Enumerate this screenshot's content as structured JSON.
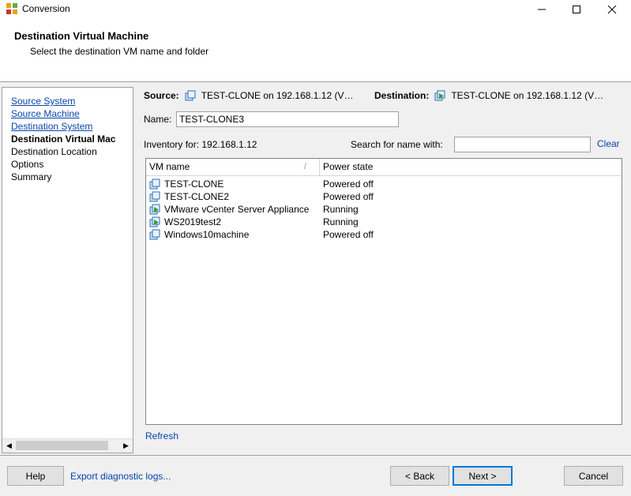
{
  "window": {
    "title": "Conversion",
    "minimize_glyph": "—",
    "maximize_glyph": "☐",
    "close_glyph": "✕"
  },
  "header": {
    "title": "Destination Virtual Machine",
    "subtitle": "Select the destination VM name and folder"
  },
  "nav": {
    "items": [
      {
        "label": "Source System",
        "state": "link"
      },
      {
        "label": "Source Machine",
        "state": "link"
      },
      {
        "label": "Destination System",
        "state": "link"
      },
      {
        "label": "Destination Virtual Mac",
        "state": "current"
      },
      {
        "label": "Destination Location",
        "state": "pending"
      },
      {
        "label": "Options",
        "state": "pending"
      },
      {
        "label": "Summary",
        "state": "pending"
      }
    ]
  },
  "summary": {
    "source_label": "Source:",
    "source_value": "TEST-CLONE on 192.168.1.12 (V…",
    "destination_label": "Destination:",
    "destination_value": "TEST-CLONE on 192.168.1.12 (V…"
  },
  "form": {
    "name_label": "Name:",
    "name_value": "TEST-CLONE3",
    "inventory_label": "Inventory for:",
    "inventory_value": "192.168.1.12",
    "search_label": "Search for name with:",
    "search_value": "",
    "clear_label": "Clear",
    "refresh_label": "Refresh"
  },
  "table": {
    "columns": [
      "VM name",
      "Power state"
    ],
    "rows": [
      {
        "name": "TEST-CLONE",
        "state": "Powered off",
        "icon": "vm-powered-off-icon"
      },
      {
        "name": "TEST-CLONE2",
        "state": "Powered off",
        "icon": "vm-powered-off-icon"
      },
      {
        "name": "VMware vCenter Server Appliance",
        "state": "Running",
        "icon": "vm-running-icon"
      },
      {
        "name": "WS2019test2",
        "state": "Running",
        "icon": "vm-running-icon"
      },
      {
        "name": "Windows10machine",
        "state": "Powered off",
        "icon": "vm-powered-off-icon"
      }
    ]
  },
  "footer": {
    "help_label": "Help",
    "diagnostic_label": "Export diagnostic logs...",
    "back_label": "< Back",
    "next_label": "Next >",
    "cancel_label": "Cancel"
  },
  "colors": {
    "link": "#0645ad",
    "panel": "#f0f0f0",
    "button": "#e1e1e1",
    "focus": "#0078d7"
  }
}
